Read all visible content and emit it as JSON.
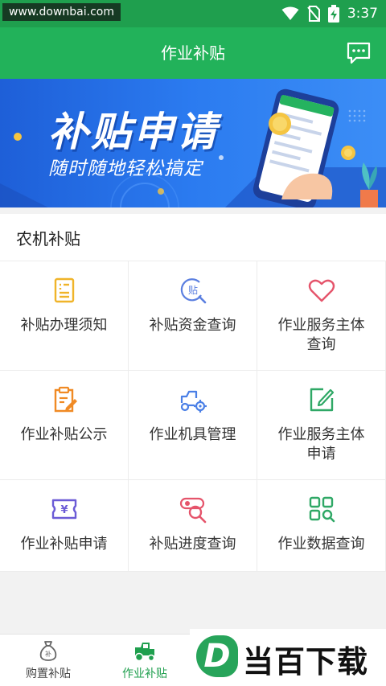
{
  "status_bar": {
    "watermark": "www.downbai.com",
    "time": "3:37"
  },
  "header": {
    "title": "作业补贴",
    "message_icon": "chat-bubble-icon"
  },
  "banner": {
    "title": "补贴申请",
    "subtitle": "随时随地轻松搞定"
  },
  "section": {
    "title": "农机补贴",
    "items": [
      {
        "label": "补贴办理须知",
        "icon": "notice-doc-icon",
        "color": "#f0b429"
      },
      {
        "label": "补贴资金查询",
        "icon": "subsidy-search-icon",
        "color": "#5b7fe0"
      },
      {
        "label": "作业服务主体\n查询",
        "icon": "heart-icon",
        "color": "#e5546b"
      },
      {
        "label": "作业补贴公示",
        "icon": "clipboard-edit-icon",
        "color": "#f08a24"
      },
      {
        "label": "作业机具管理",
        "icon": "tractor-gear-icon",
        "color": "#4a7fe6"
      },
      {
        "label": "作业服务主体\n申请",
        "icon": "edit-square-icon",
        "color": "#2fa866"
      },
      {
        "label": "作业补贴申请",
        "icon": "yuan-ticket-icon",
        "color": "#6b5bd6"
      },
      {
        "label": "补贴进度查询",
        "icon": "progress-search-icon",
        "color": "#e5546b"
      },
      {
        "label": "作业数据查询",
        "icon": "grid-search-icon",
        "color": "#2fa866"
      }
    ]
  },
  "bottom_nav": {
    "items": [
      {
        "label": "购置补贴",
        "icon": "money-bag-icon"
      },
      {
        "label": "作业补贴",
        "icon": "tractor-icon"
      }
    ]
  },
  "logo_watermark": {
    "letter": "D",
    "text": "当百下载"
  },
  "colors": {
    "primary": "#22b25a",
    "status": "#1f9f4e",
    "banner": "#2b7bf0"
  }
}
